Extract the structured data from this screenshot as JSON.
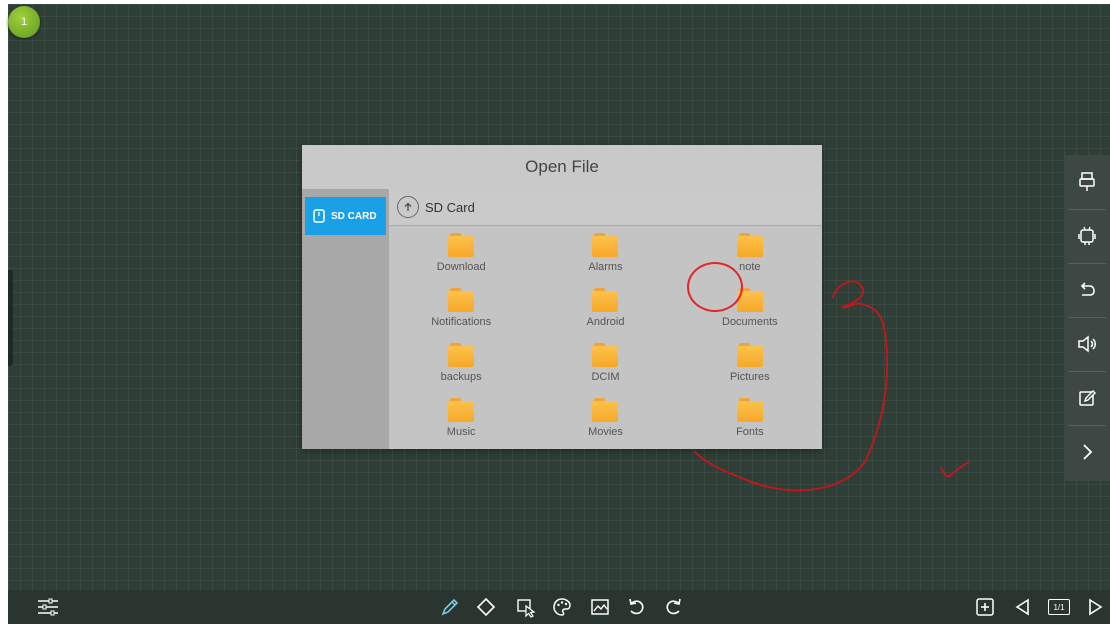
{
  "page_badge": "1",
  "dialog": {
    "title": "Open File",
    "sidebar": {
      "tab_label": "SD CARD"
    },
    "path": "SD Card",
    "files": [
      "Download",
      "Alarms",
      "note",
      "Notifications",
      "Android",
      "Documents",
      "backups",
      "DCIM",
      "Pictures",
      "Music",
      "Movies",
      "Fonts"
    ]
  },
  "right_toolbar": [
    "usb-icon",
    "android-icon",
    "return-icon",
    "volume-icon",
    "annotate-icon",
    "chevron-right-icon"
  ],
  "bottom_toolbar": {
    "left": [
      "settings-sliders-icon"
    ],
    "center": [
      "pen-icon",
      "eraser-icon",
      "select-icon",
      "palette-icon",
      "insert-image-icon",
      "undo-icon",
      "redo-icon"
    ],
    "right": [
      "add-page-icon",
      "previous-page-icon",
      "page-indicator",
      "next-page-icon"
    ],
    "page_indicator": "1/1"
  },
  "colors": {
    "board": "#2f3f37",
    "accent_tab": "#1aa0e6",
    "folder": "#f6a829",
    "annotation_ink": "#c8141c",
    "pen_active": "#7ec8e3"
  }
}
